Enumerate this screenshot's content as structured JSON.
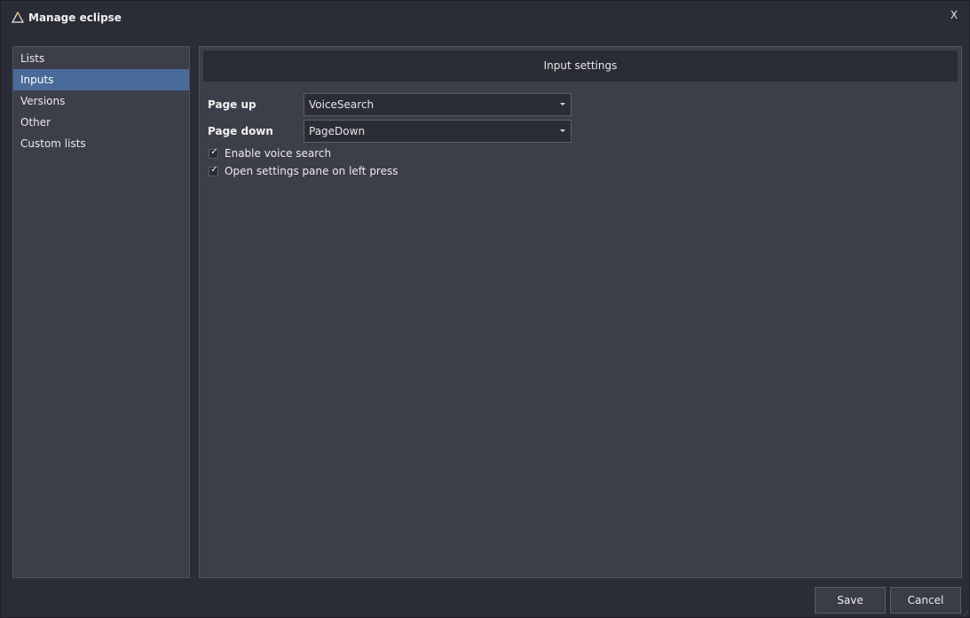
{
  "window": {
    "title": "Manage eclipse",
    "close_label": "X",
    "accent_color": "#4a6a9a",
    "app_icon": "triangle-logo-icon"
  },
  "sidebar": {
    "items": [
      {
        "label": "Lists",
        "active": false
      },
      {
        "label": "Inputs",
        "active": true
      },
      {
        "label": "Versions",
        "active": false
      },
      {
        "label": "Other",
        "active": false
      },
      {
        "label": "Custom lists",
        "active": false
      }
    ]
  },
  "main": {
    "header": "Input settings",
    "fields": [
      {
        "label": "Page up",
        "value": "VoiceSearch"
      },
      {
        "label": "Page down",
        "value": "PageDown"
      }
    ],
    "checkboxes": [
      {
        "label": "Enable voice search",
        "checked": true
      },
      {
        "label": "Open settings pane on left press",
        "checked": true
      }
    ]
  },
  "footer": {
    "save_label": "Save",
    "cancel_label": "Cancel"
  }
}
